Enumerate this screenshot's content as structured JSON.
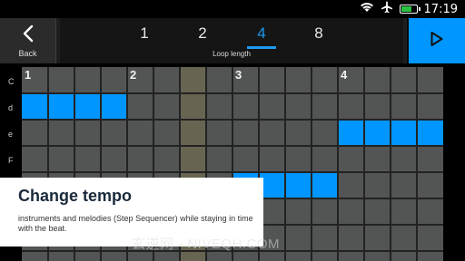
{
  "status_bar": {
    "time": "17:19"
  },
  "toolbar": {
    "back_label": "Back",
    "loop_options": [
      "1",
      "2",
      "4",
      "8"
    ],
    "selected_loop": "4",
    "loop_caption": "Loop length"
  },
  "sequencer": {
    "row_labels": [
      "C",
      "d",
      "e",
      "F",
      "",
      "",
      ""
    ],
    "beat_markers": [
      "1",
      "2",
      "3",
      "4"
    ]
  },
  "overlay": {
    "title": "Change tempo",
    "body": "instruments and melodies (Step Sequencer) while staying in time with the beat."
  },
  "watermark": "玄逆网 - NIVEQH.COM",
  "colors": {
    "accent": "#0096ff",
    "grid_cell": "#525553",
    "grid_line": "#222222",
    "toolbar": "#1e1e1e",
    "battery": "#27c241"
  }
}
